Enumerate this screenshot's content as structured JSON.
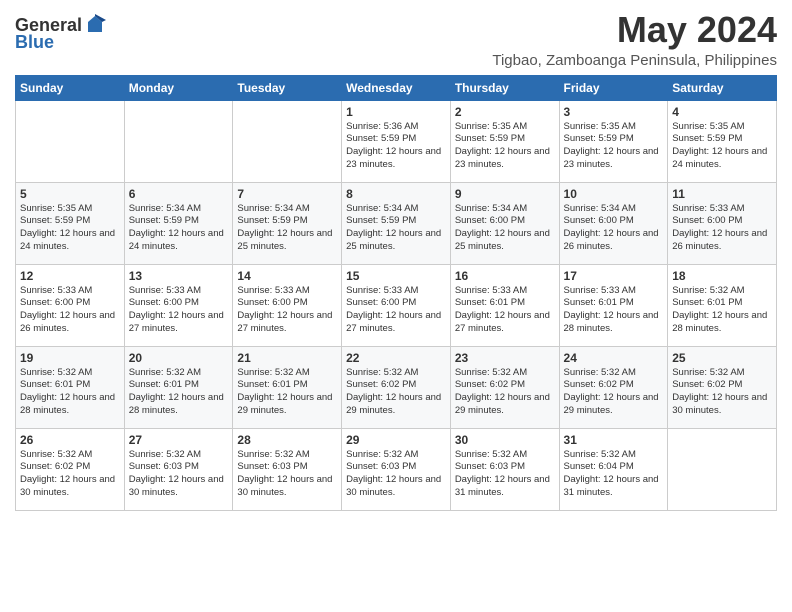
{
  "header": {
    "logo_general": "General",
    "logo_blue": "Blue",
    "month_year": "May 2024",
    "location": "Tigbao, Zamboanga Peninsula, Philippines"
  },
  "weekdays": [
    "Sunday",
    "Monday",
    "Tuesday",
    "Wednesday",
    "Thursday",
    "Friday",
    "Saturday"
  ],
  "weeks": [
    [
      {
        "day": "",
        "content": ""
      },
      {
        "day": "",
        "content": ""
      },
      {
        "day": "",
        "content": ""
      },
      {
        "day": "1",
        "content": "Sunrise: 5:36 AM\nSunset: 5:59 PM\nDaylight: 12 hours and 23 minutes."
      },
      {
        "day": "2",
        "content": "Sunrise: 5:35 AM\nSunset: 5:59 PM\nDaylight: 12 hours and 23 minutes."
      },
      {
        "day": "3",
        "content": "Sunrise: 5:35 AM\nSunset: 5:59 PM\nDaylight: 12 hours and 23 minutes."
      },
      {
        "day": "4",
        "content": "Sunrise: 5:35 AM\nSunset: 5:59 PM\nDaylight: 12 hours and 24 minutes."
      }
    ],
    [
      {
        "day": "5",
        "content": "Sunrise: 5:35 AM\nSunset: 5:59 PM\nDaylight: 12 hours and 24 minutes."
      },
      {
        "day": "6",
        "content": "Sunrise: 5:34 AM\nSunset: 5:59 PM\nDaylight: 12 hours and 24 minutes."
      },
      {
        "day": "7",
        "content": "Sunrise: 5:34 AM\nSunset: 5:59 PM\nDaylight: 12 hours and 25 minutes."
      },
      {
        "day": "8",
        "content": "Sunrise: 5:34 AM\nSunset: 5:59 PM\nDaylight: 12 hours and 25 minutes."
      },
      {
        "day": "9",
        "content": "Sunrise: 5:34 AM\nSunset: 6:00 PM\nDaylight: 12 hours and 25 minutes."
      },
      {
        "day": "10",
        "content": "Sunrise: 5:34 AM\nSunset: 6:00 PM\nDaylight: 12 hours and 26 minutes."
      },
      {
        "day": "11",
        "content": "Sunrise: 5:33 AM\nSunset: 6:00 PM\nDaylight: 12 hours and 26 minutes."
      }
    ],
    [
      {
        "day": "12",
        "content": "Sunrise: 5:33 AM\nSunset: 6:00 PM\nDaylight: 12 hours and 26 minutes."
      },
      {
        "day": "13",
        "content": "Sunrise: 5:33 AM\nSunset: 6:00 PM\nDaylight: 12 hours and 27 minutes."
      },
      {
        "day": "14",
        "content": "Sunrise: 5:33 AM\nSunset: 6:00 PM\nDaylight: 12 hours and 27 minutes."
      },
      {
        "day": "15",
        "content": "Sunrise: 5:33 AM\nSunset: 6:00 PM\nDaylight: 12 hours and 27 minutes."
      },
      {
        "day": "16",
        "content": "Sunrise: 5:33 AM\nSunset: 6:01 PM\nDaylight: 12 hours and 27 minutes."
      },
      {
        "day": "17",
        "content": "Sunrise: 5:33 AM\nSunset: 6:01 PM\nDaylight: 12 hours and 28 minutes."
      },
      {
        "day": "18",
        "content": "Sunrise: 5:32 AM\nSunset: 6:01 PM\nDaylight: 12 hours and 28 minutes."
      }
    ],
    [
      {
        "day": "19",
        "content": "Sunrise: 5:32 AM\nSunset: 6:01 PM\nDaylight: 12 hours and 28 minutes."
      },
      {
        "day": "20",
        "content": "Sunrise: 5:32 AM\nSunset: 6:01 PM\nDaylight: 12 hours and 28 minutes."
      },
      {
        "day": "21",
        "content": "Sunrise: 5:32 AM\nSunset: 6:01 PM\nDaylight: 12 hours and 29 minutes."
      },
      {
        "day": "22",
        "content": "Sunrise: 5:32 AM\nSunset: 6:02 PM\nDaylight: 12 hours and 29 minutes."
      },
      {
        "day": "23",
        "content": "Sunrise: 5:32 AM\nSunset: 6:02 PM\nDaylight: 12 hours and 29 minutes."
      },
      {
        "day": "24",
        "content": "Sunrise: 5:32 AM\nSunset: 6:02 PM\nDaylight: 12 hours and 29 minutes."
      },
      {
        "day": "25",
        "content": "Sunrise: 5:32 AM\nSunset: 6:02 PM\nDaylight: 12 hours and 30 minutes."
      }
    ],
    [
      {
        "day": "26",
        "content": "Sunrise: 5:32 AM\nSunset: 6:02 PM\nDaylight: 12 hours and 30 minutes."
      },
      {
        "day": "27",
        "content": "Sunrise: 5:32 AM\nSunset: 6:03 PM\nDaylight: 12 hours and 30 minutes."
      },
      {
        "day": "28",
        "content": "Sunrise: 5:32 AM\nSunset: 6:03 PM\nDaylight: 12 hours and 30 minutes."
      },
      {
        "day": "29",
        "content": "Sunrise: 5:32 AM\nSunset: 6:03 PM\nDaylight: 12 hours and 30 minutes."
      },
      {
        "day": "30",
        "content": "Sunrise: 5:32 AM\nSunset: 6:03 PM\nDaylight: 12 hours and 31 minutes."
      },
      {
        "day": "31",
        "content": "Sunrise: 5:32 AM\nSunset: 6:04 PM\nDaylight: 12 hours and 31 minutes."
      },
      {
        "day": "",
        "content": ""
      }
    ]
  ]
}
